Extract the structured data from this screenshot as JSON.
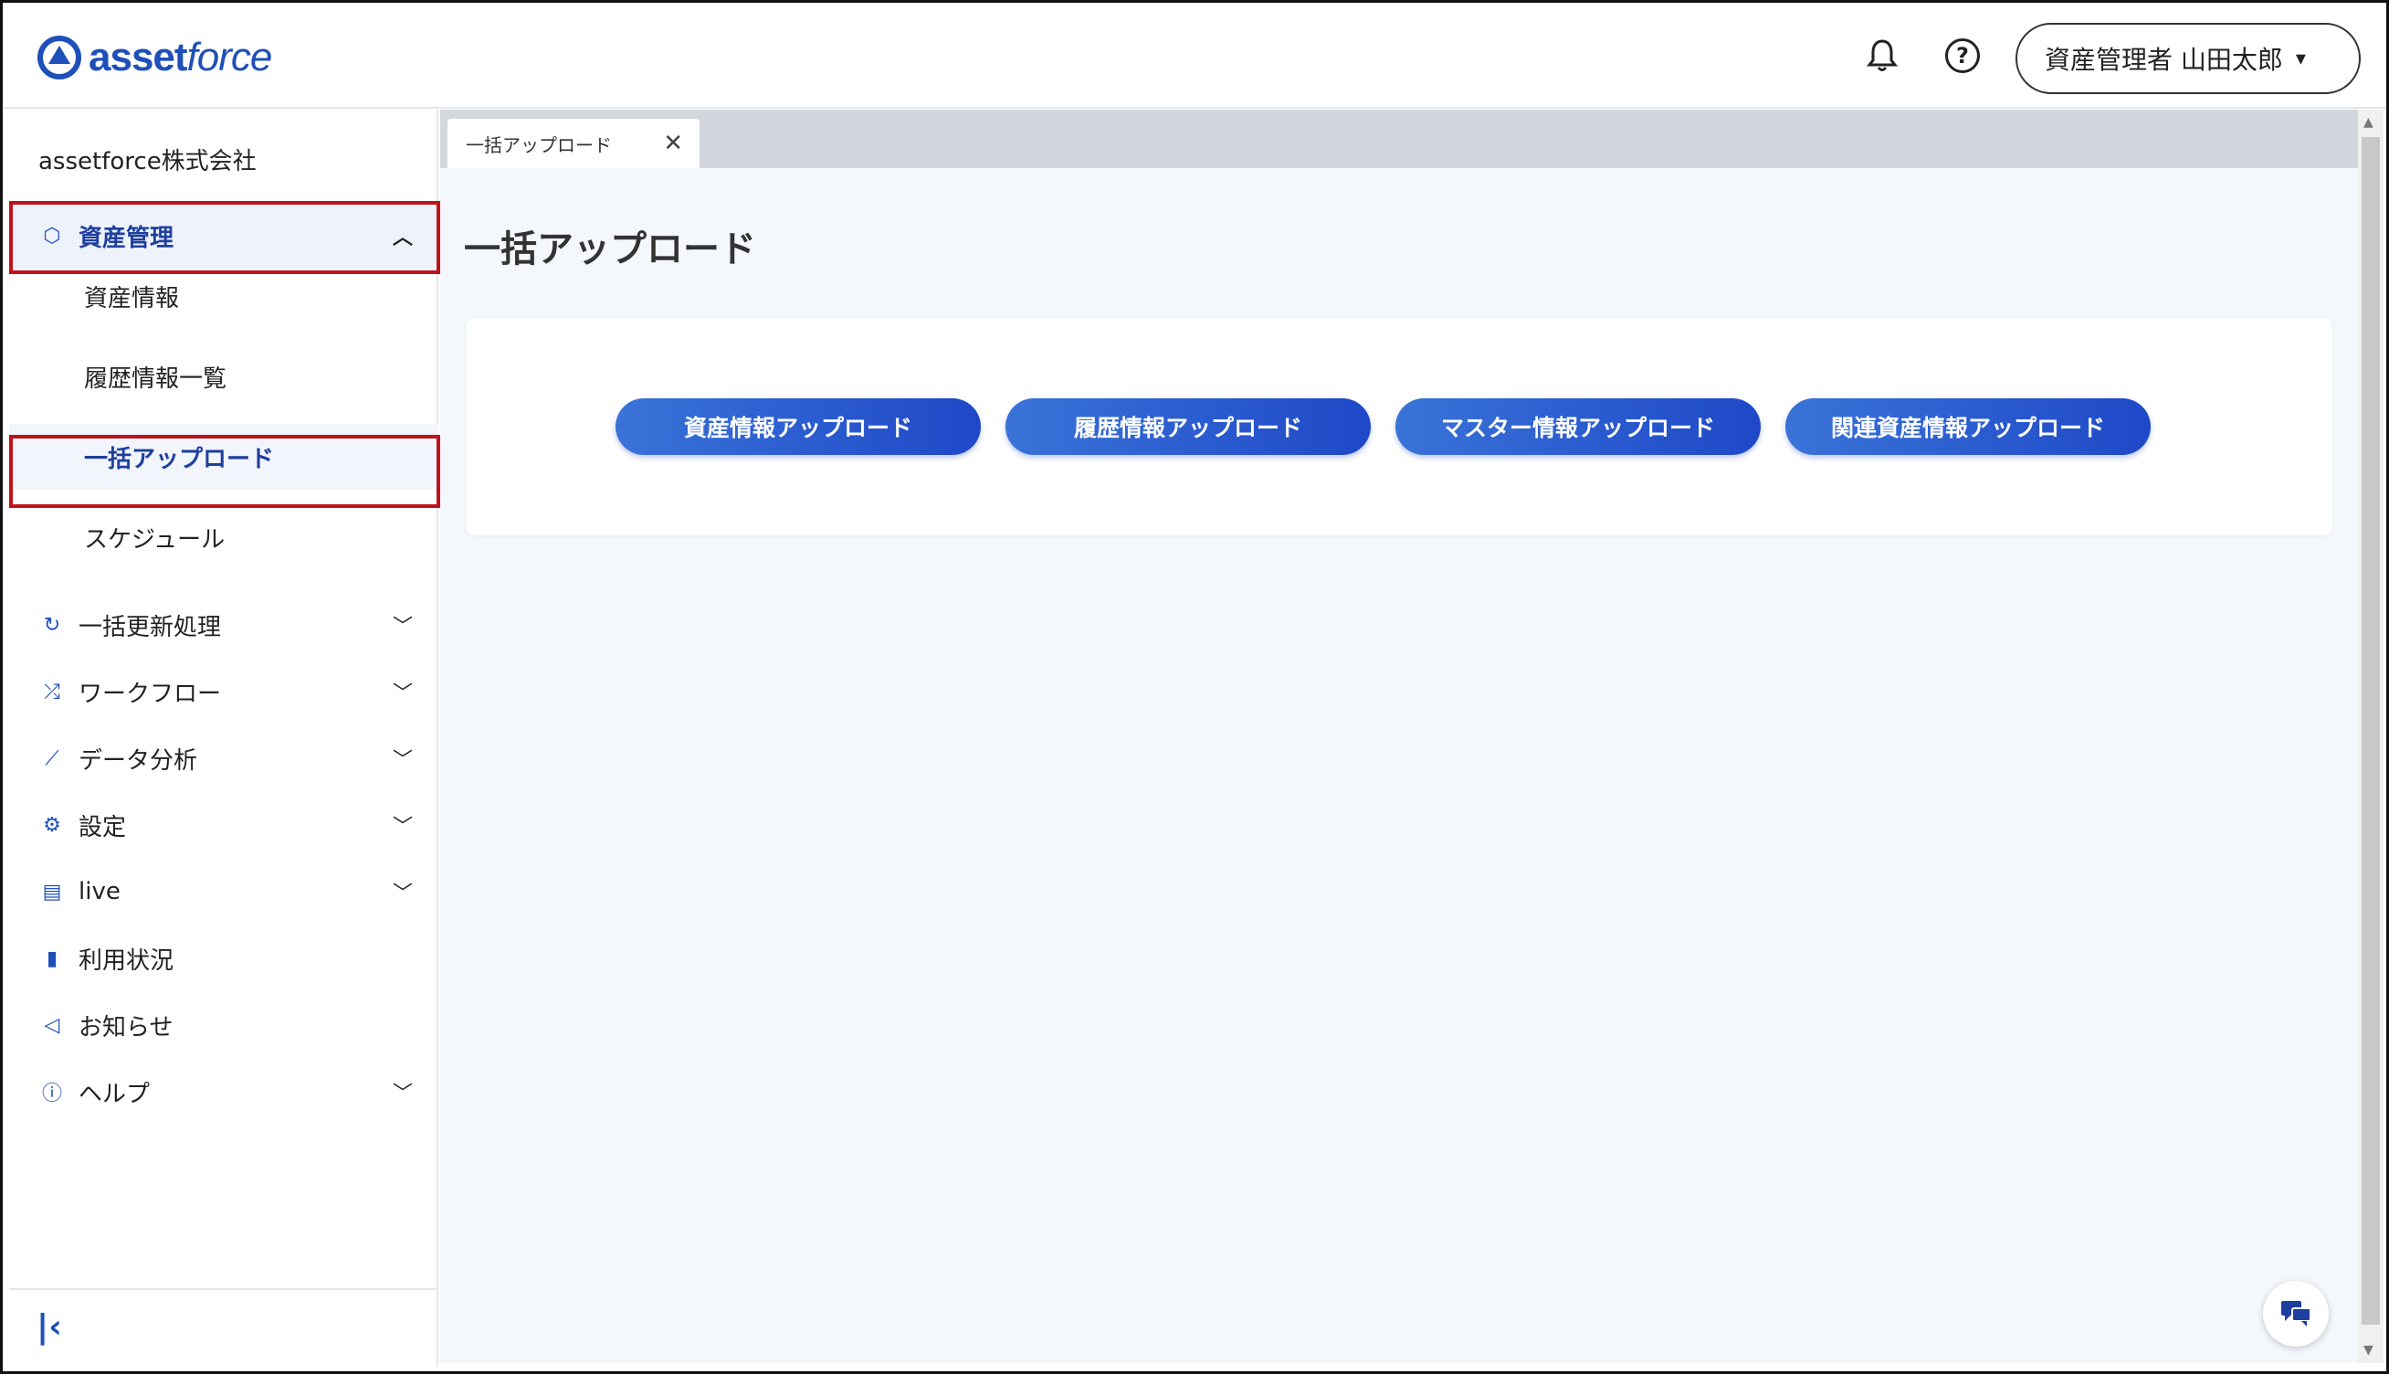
{
  "header": {
    "logo_text_bold": "asset",
    "logo_text_italic": "force",
    "user_label": "資産管理者 山田太郎"
  },
  "sidebar": {
    "company": "assetforce株式会社",
    "items": [
      {
        "label": "資産管理",
        "icon": "box-icon"
      },
      {
        "label": "資産情報"
      },
      {
        "label": "履歴情報一覧"
      },
      {
        "label": "一括アップロード"
      },
      {
        "label": "スケジュール"
      },
      {
        "label": "一括更新処理",
        "icon": "refresh-icon"
      },
      {
        "label": "ワークフロー",
        "icon": "workflow-icon"
      },
      {
        "label": "データ分析",
        "icon": "analytics-icon"
      },
      {
        "label": "設定",
        "icon": "gear-icon"
      },
      {
        "label": "live",
        "icon": "live-chat-icon"
      },
      {
        "label": "利用状況",
        "icon": "bar-chart-icon"
      },
      {
        "label": "お知らせ",
        "icon": "megaphone-icon"
      },
      {
        "label": "ヘルプ",
        "icon": "help-circle-icon"
      }
    ]
  },
  "main": {
    "tab_label": "一括アップロード",
    "page_title": "一括アップロード",
    "buttons": [
      "資産情報アップロード",
      "履歴情報アップロード",
      "マスター情報アップロード",
      "関連資産情報アップロード"
    ]
  },
  "colors": {
    "brand": "#1f4fb8",
    "highlight": "#c0121b",
    "button_start": "#3a73d8",
    "button_end": "#1e48c8"
  }
}
